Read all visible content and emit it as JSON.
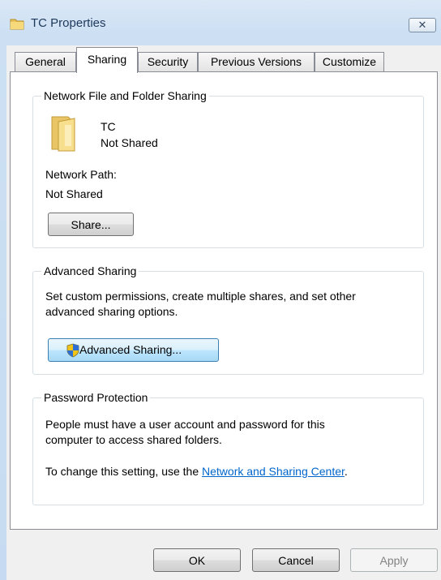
{
  "window": {
    "title": "TC Properties",
    "close_glyph": "✕"
  },
  "tabs": [
    {
      "label": "General"
    },
    {
      "label": "Sharing"
    },
    {
      "label": "Security"
    },
    {
      "label": "Previous Versions"
    },
    {
      "label": "Customize"
    }
  ],
  "active_tab": "Sharing",
  "network_sharing": {
    "label": "Network File and Folder Sharing",
    "folder_name": "TC",
    "status": "Not Shared",
    "path_label": "Network Path:",
    "path_value": "Not Shared",
    "share_button": "Share..."
  },
  "advanced_sharing": {
    "label": "Advanced Sharing",
    "description_line1": "Set custom permissions, create multiple shares, and set other",
    "description_line2": "advanced sharing options.",
    "button": "Advanced Sharing..."
  },
  "password_protection": {
    "label": "Password Protection",
    "description_line1": "People must have a user account and password for this",
    "description_line2": "computer to access shared folders.",
    "change_prefix": "To change this setting, use the ",
    "link_text": "Network and Sharing Center",
    "change_suffix": "."
  },
  "dialog_buttons": {
    "ok": "OK",
    "cancel": "Cancel",
    "apply": "Apply"
  },
  "colors": {
    "link": "#0066cc",
    "title_text": "#1e395b",
    "disabled_text": "#838383"
  },
  "icons": {
    "title": "folder-icon",
    "folder": "folder-icon",
    "shield": "uac-shield-icon"
  }
}
